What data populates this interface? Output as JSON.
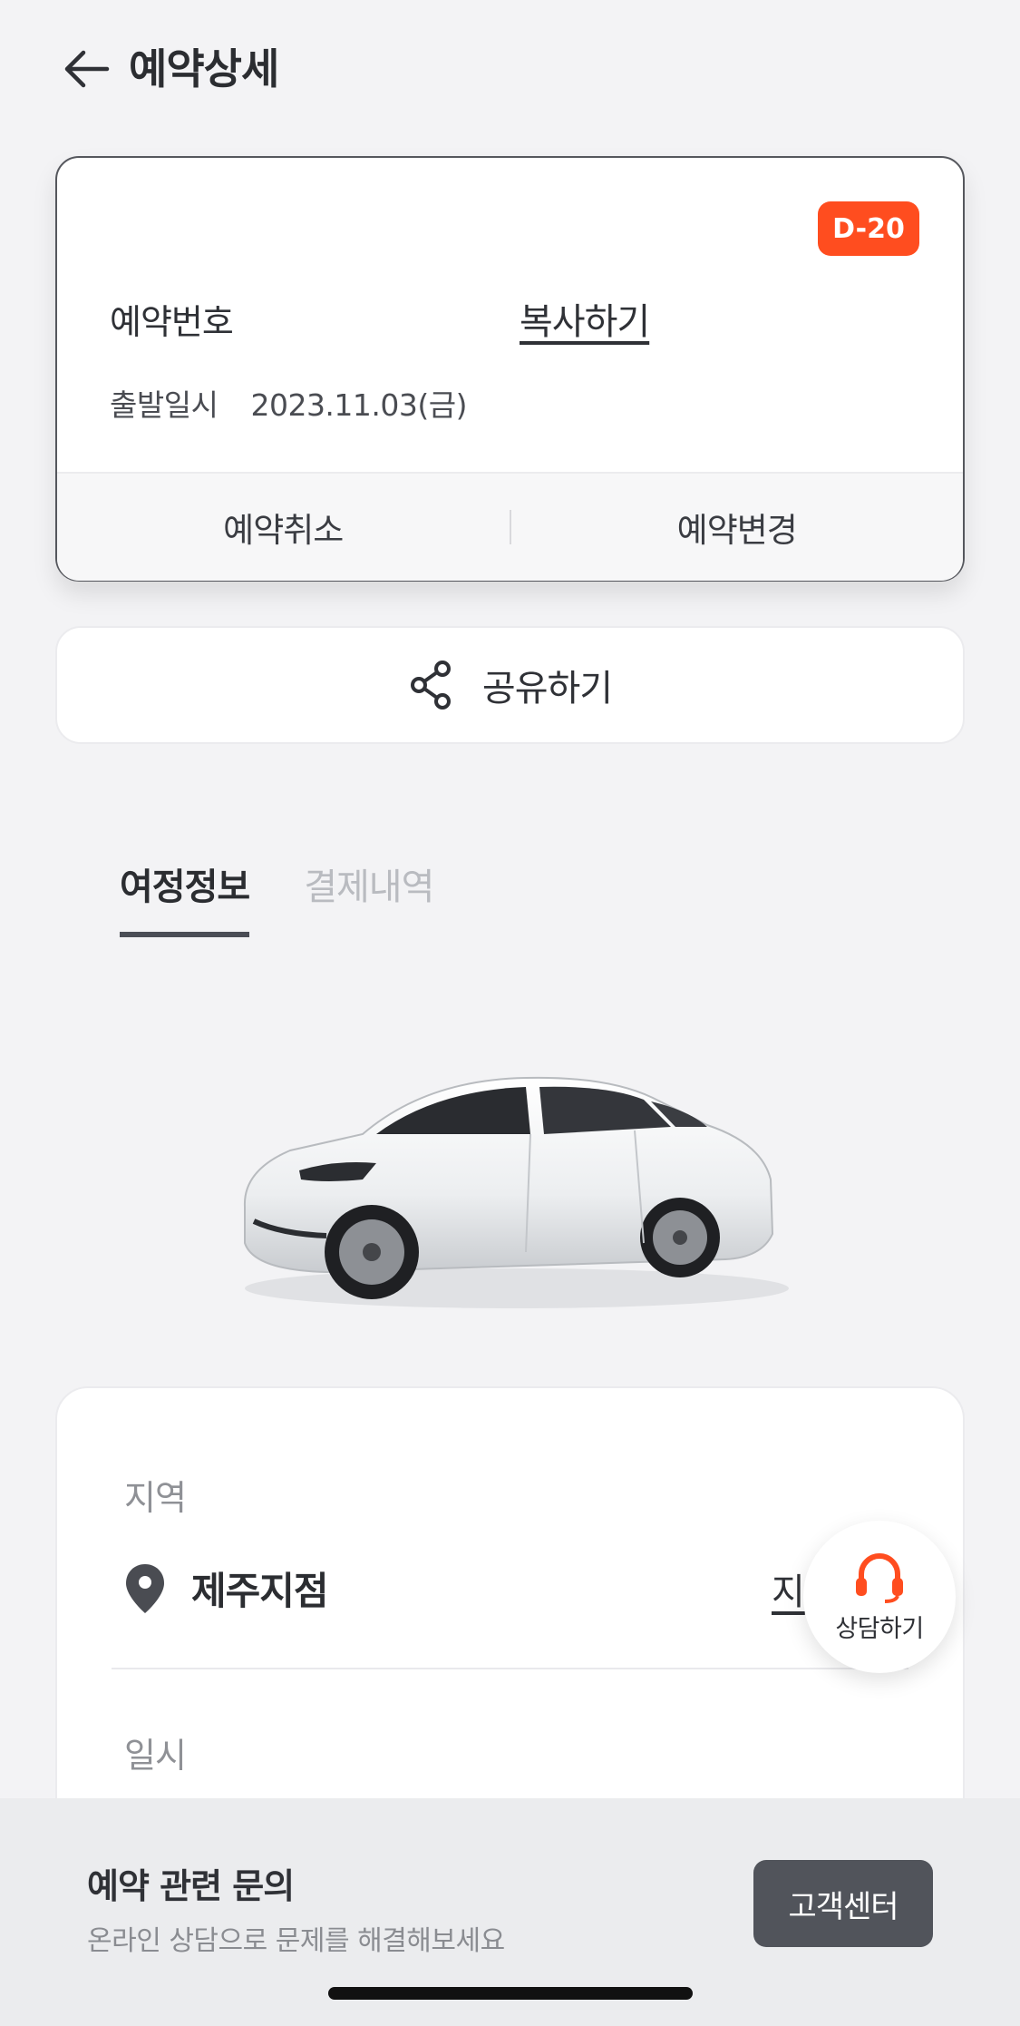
{
  "header": {
    "title": "예약상세"
  },
  "reservation": {
    "dday": "D-20",
    "number_label": "예약번호",
    "copy_label": "복사하기",
    "depart_label": "출발일시",
    "depart_date": "2023.11.03(금)",
    "cancel_label": "예약취소",
    "change_label": "예약변경"
  },
  "share": {
    "label": "공유하기"
  },
  "tabs": [
    {
      "label": "여정정보",
      "active": true
    },
    {
      "label": "결제내역",
      "active": false
    }
  ],
  "info": {
    "region_label": "지역",
    "location_name": "제주지점",
    "map_link": "지",
    "datetime_label": "일시"
  },
  "floating": {
    "label": "상담하기"
  },
  "bottom": {
    "title": "예약 관련 문의",
    "subtitle": "온라인 상담으로 문제를 해결해보세요",
    "button": "고객센터"
  },
  "colors": {
    "accent": "#ff4d1f",
    "dark": "#51545b"
  }
}
